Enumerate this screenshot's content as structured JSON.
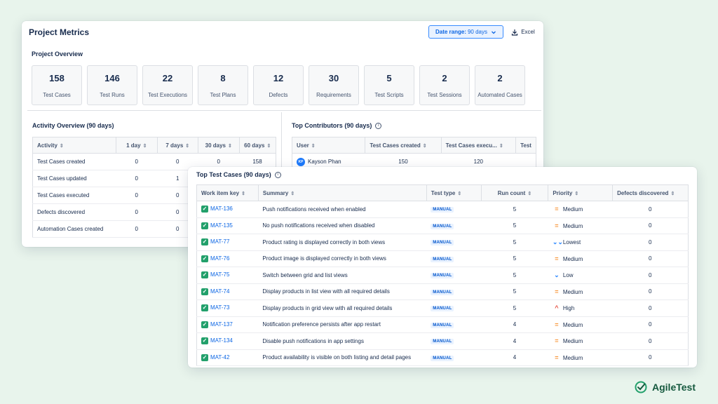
{
  "header": {
    "title": "Project Metrics",
    "date_range_label": "Date range:",
    "date_range_value": "90 days",
    "excel_label": "Excel"
  },
  "overview": {
    "title": "Project Overview",
    "cards": [
      {
        "value": "158",
        "label": "Test Cases"
      },
      {
        "value": "146",
        "label": "Test Runs"
      },
      {
        "value": "22",
        "label": "Test Executions"
      },
      {
        "value": "8",
        "label": "Test Plans"
      },
      {
        "value": "12",
        "label": "Defects"
      },
      {
        "value": "30",
        "label": "Requirements"
      },
      {
        "value": "5",
        "label": "Test Scripts"
      },
      {
        "value": "2",
        "label": "Test Sessions"
      },
      {
        "value": "2",
        "label": "Automated Cases"
      }
    ]
  },
  "activity": {
    "title": "Activity Overview (90 days)",
    "columns": [
      "Activity",
      "1 day",
      "7 days",
      "30 days",
      "60 days"
    ],
    "rows": [
      [
        "Test Cases created",
        "0",
        "0",
        "0",
        "158"
      ],
      [
        "Test Cases updated",
        "0",
        "1",
        "",
        ""
      ],
      [
        "Test Cases executed",
        "0",
        "0",
        "",
        ""
      ],
      [
        "Defects discovered",
        "0",
        "0",
        "",
        ""
      ],
      [
        "Automation Cases created",
        "0",
        "0",
        "",
        ""
      ]
    ]
  },
  "contributors": {
    "title": "Top Contributors (90 days)",
    "columns": [
      "User",
      "Test Cases created",
      "Test Cases execu...",
      "Test"
    ],
    "rows": [
      {
        "initials": "KP",
        "name": "Kayson Phan",
        "created": "150",
        "executed": "120"
      }
    ]
  },
  "top_tests": {
    "title": "Top Test Cases (90 days)",
    "columns": [
      "Work item key",
      "Summary",
      "Test type",
      "Run count",
      "Priority",
      "Defects discovered"
    ],
    "rows": [
      {
        "key": "MAT-136",
        "summary": "Push notifications received when enabled",
        "type": "MANUAL",
        "runs": "5",
        "priority": "Medium",
        "prio_icon": "=",
        "defects": "0"
      },
      {
        "key": "MAT-135",
        "summary": "No push notifications received when disabled",
        "type": "MANUAL",
        "runs": "5",
        "priority": "Medium",
        "prio_icon": "=",
        "defects": "0"
      },
      {
        "key": "MAT-77",
        "summary": "Product rating is displayed correctly in both views",
        "type": "MANUAL",
        "runs": "5",
        "priority": "Lowest",
        "prio_icon": "⌄⌄",
        "defects": "0"
      },
      {
        "key": "MAT-76",
        "summary": "Product image is displayed correctly in both views",
        "type": "MANUAL",
        "runs": "5",
        "priority": "Medium",
        "prio_icon": "=",
        "defects": "0"
      },
      {
        "key": "MAT-75",
        "summary": "Switch between grid and list views",
        "type": "MANUAL",
        "runs": "5",
        "priority": "Low",
        "prio_icon": "⌄",
        "defects": "0"
      },
      {
        "key": "MAT-74",
        "summary": "Display products in list view with all required details",
        "type": "MANUAL",
        "runs": "5",
        "priority": "Medium",
        "prio_icon": "=",
        "defects": "0"
      },
      {
        "key": "MAT-73",
        "summary": "Display products in grid view with all required details",
        "type": "MANUAL",
        "runs": "5",
        "priority": "High",
        "prio_icon": "^",
        "defects": "0"
      },
      {
        "key": "MAT-137",
        "summary": "Notification preference persists after app restart",
        "type": "MANUAL",
        "runs": "4",
        "priority": "Medium",
        "prio_icon": "=",
        "defects": "0"
      },
      {
        "key": "MAT-134",
        "summary": "Disable push notifications in app settings",
        "type": "MANUAL",
        "runs": "4",
        "priority": "Medium",
        "prio_icon": "=",
        "defects": "0"
      },
      {
        "key": "MAT-42",
        "summary": "Product availability is visible on both listing and detail pages",
        "type": "MANUAL",
        "runs": "4",
        "priority": "Medium",
        "prio_icon": "=",
        "defects": "0"
      }
    ]
  },
  "brand": {
    "name": "AgileTest",
    "color": "#15593e",
    "accent": "#22a06b"
  }
}
